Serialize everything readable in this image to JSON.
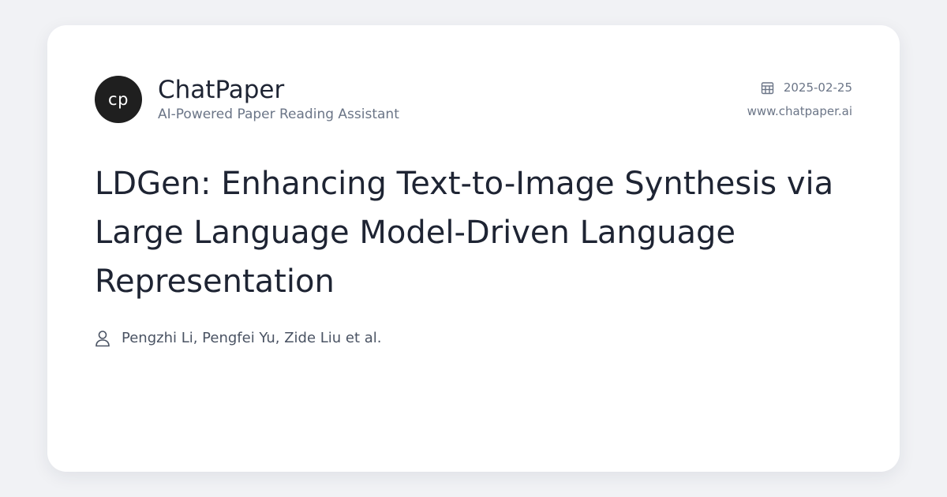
{
  "brand": {
    "logo_text": "cp",
    "name": "ChatPaper",
    "tagline": "AI-Powered Paper Reading Assistant"
  },
  "meta": {
    "date": "2025-02-25",
    "site": "www.chatpaper.ai"
  },
  "paper": {
    "title": "LDGen: Enhancing Text-to-Image Synthesis via Large Language Model-Driven Language Representation",
    "authors": "Pengzhi Li, Pengfei Yu, Zide Liu et al."
  },
  "icons": {
    "date": "calendar-icon",
    "authors": "user-icon"
  },
  "colors": {
    "background": "#f1f2f5",
    "card": "#ffffff",
    "logo_bg": "#1f1f1f",
    "title_text": "#1e2433",
    "muted_text": "#6b7587"
  }
}
